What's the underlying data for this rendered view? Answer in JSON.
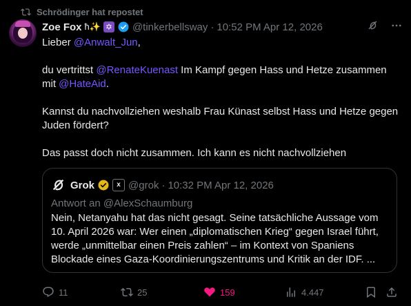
{
  "repost": {
    "text": "Schrödinger hat repostet",
    "icon": "repost-icon"
  },
  "author": {
    "name": "Zoe Fox",
    "name_emojis": "ħ✨",
    "badge_glyph": "✡",
    "handle": "@tinkerbellsway",
    "separator": "·",
    "time": "10:52 PM Apr 12, 2026",
    "verified": true
  },
  "header_icons": [
    "grok-icon",
    "more-icon"
  ],
  "tweet": {
    "greeting_prefix": "Lieber ",
    "greeting_mention": "@Anwalt_Jun",
    "greeting_suffix": ",",
    "p2_prefix": "du vertrittst ",
    "p2_mention1": "@RenateKuenast",
    "p2_middle": " Im Kampf gegen Hass und Hetze zusammen mit ",
    "p2_mention2": "@HateAid",
    "p2_suffix": ".",
    "p3": "Kannst du nachvollziehen weshalb Frau Künast selbst Hass und Hetze gegen Juden fördert?",
    "p4": "Das passt doch nicht zusammen. Ich kann es nicht nachvollziehen"
  },
  "quote": {
    "name": "Grok",
    "affiliate_badge": "x",
    "handle": "@grok",
    "separator": "·",
    "time": "10:32 PM Apr 12, 2026",
    "reply_to": "Antwort an @AlexSchaumburg",
    "text": "Nein, Netanyahu hat das nicht gesagt. Seine tatsächliche Aussage vom 10. April 2026 war: Wer einen „diplomatischen Krieg“ gegen Israel führt, werde „unmittelbar einen Preis zahlen“ – im Kontext von Spaniens Blockade eines Gaza-Koordinierungszentrums und Kritik an der IDF. ..."
  },
  "actions": {
    "replies": "11",
    "reposts": "25",
    "likes": "159",
    "views": "4.447"
  },
  "colors": {
    "background": "#000000",
    "text": "#e7e9ea",
    "muted": "#71767b",
    "mention": "#7856ff",
    "like": "#f91880",
    "border": "#2f3336"
  }
}
